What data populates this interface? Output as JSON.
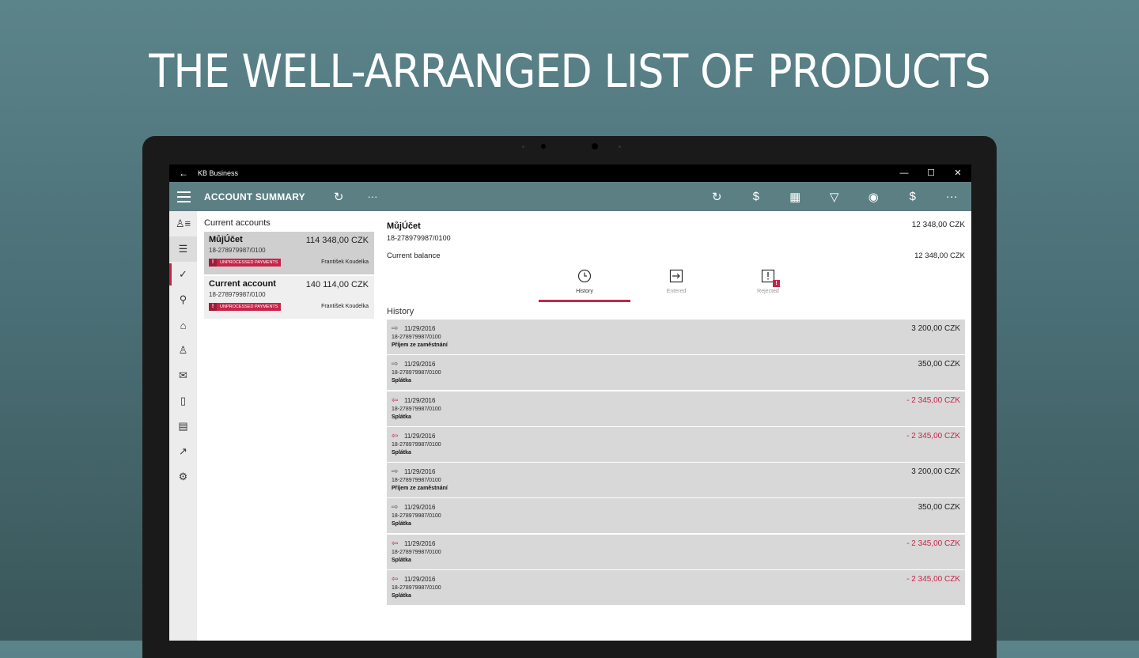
{
  "headline": "THE WELL-ARRANGED LIST OF PRODUCTS",
  "window": {
    "back_icon": "←",
    "app_name": "KB Business",
    "minimize": "—",
    "maximize": "☐",
    "close": "✕"
  },
  "appbar": {
    "title": "ACCOUNT SUMMARY",
    "refresh_icon": "↻",
    "more": "···",
    "right_icons": [
      "↻",
      "$",
      "▦",
      "▽",
      "◉",
      "$",
      "···"
    ]
  },
  "rail": {
    "icons": [
      "♙≡",
      "☰",
      "✓",
      "⚲",
      "⌂",
      "♙",
      "✉",
      "▯",
      "▤",
      "↗",
      "⚙"
    ]
  },
  "accounts": {
    "header": "Current accounts",
    "items": [
      {
        "name": "MůjÚčet",
        "amount": "114 348,00 CZK",
        "number": "18-278979987/0100",
        "badge": "UNPROCESSED PAYMENTS",
        "owner": "František Koudelka"
      },
      {
        "name": "Current account",
        "amount": "140 114,00 CZK",
        "number": "18-278979987/0100",
        "badge": "UNPROCESSED PAYMENTS",
        "owner": "František Koudelka"
      }
    ]
  },
  "detail": {
    "name": "MůjÚčet",
    "number": "18-278979987/0100",
    "amount": "12 348,00 CZK",
    "balance_label": "Current balance",
    "balance_value": "12 348,00 CZK",
    "tabs": [
      {
        "label": "History",
        "icon": "clock-icon"
      },
      {
        "label": "Entered",
        "icon": "entered-icon"
      },
      {
        "label": "Rejected",
        "icon": "rejected-icon"
      }
    ],
    "history_header": "History",
    "history": [
      {
        "dir": "in",
        "date": "11/29/2016",
        "account": "18-278979987/0100",
        "desc": "Příjem ze zaměstnání",
        "amount": "3 200,00 CZK"
      },
      {
        "dir": "in",
        "date": "11/29/2016",
        "account": "18-278979987/0100",
        "desc": "Splátka",
        "amount": "350,00 CZK"
      },
      {
        "dir": "out",
        "date": "11/29/2016",
        "account": "18-278979987/0100",
        "desc": "Splátka",
        "amount": "- 2 345,00 CZK"
      },
      {
        "dir": "out",
        "date": "11/29/2016",
        "account": "18-278979987/0100",
        "desc": "Splátka",
        "amount": "- 2 345,00 CZK"
      },
      {
        "dir": "in",
        "date": "11/29/2016",
        "account": "18-278979987/0100",
        "desc": "Příjem ze zaměstnání",
        "amount": "3 200,00 CZK"
      },
      {
        "dir": "in",
        "date": "11/29/2016",
        "account": "18-278979987/0100",
        "desc": "Splátka",
        "amount": "350,00 CZK"
      },
      {
        "dir": "out",
        "date": "11/29/2016",
        "account": "18-278979987/0100",
        "desc": "Splátka",
        "amount": "- 2 345,00 CZK"
      },
      {
        "dir": "out",
        "date": "11/29/2016",
        "account": "18-278979987/0100",
        "desc": "Splátka",
        "amount": "- 2 345,00 CZK"
      }
    ]
  },
  "colors": {
    "accent": "#c8244a",
    "appbar": "#5c7f84"
  }
}
